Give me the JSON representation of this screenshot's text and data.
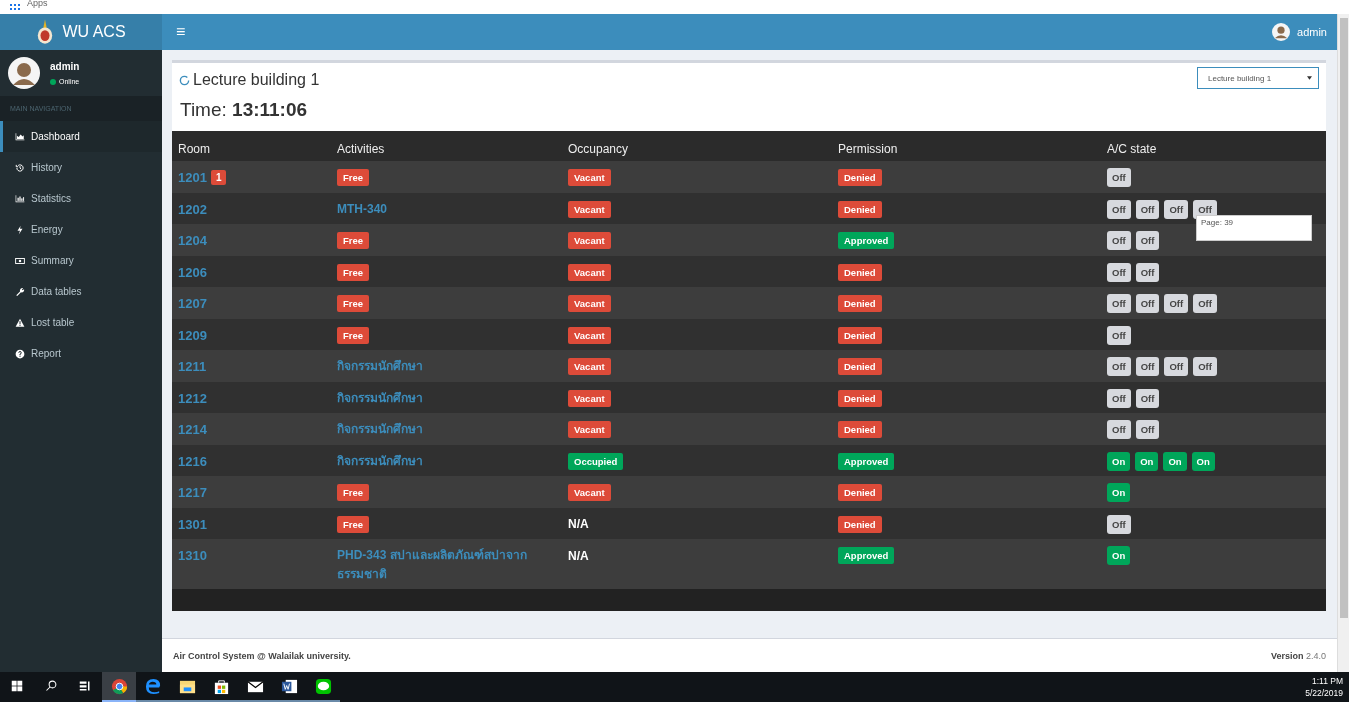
{
  "browser_bar": {
    "apps_label": "Apps"
  },
  "header": {
    "brand": "WU ACS",
    "menu_glyph": "≡",
    "user": "admin"
  },
  "sidebar": {
    "user": {
      "name": "admin",
      "status": "Online"
    },
    "section_label": "MAIN NAVIGATION",
    "items": [
      {
        "label": "Dashboard",
        "selected": true
      },
      {
        "label": "History",
        "selected": false
      },
      {
        "label": "Statistics",
        "selected": false
      },
      {
        "label": "Energy",
        "selected": false
      },
      {
        "label": "Summary",
        "selected": false
      },
      {
        "label": "Data tables",
        "selected": false
      },
      {
        "label": "Lost table",
        "selected": false
      },
      {
        "label": "Report",
        "selected": false
      }
    ]
  },
  "content": {
    "title": "Lecture building 1",
    "time_label": "Time:",
    "time": "13:11:06",
    "building_select": {
      "value": "Lecture building 1"
    },
    "table": {
      "columns": [
        "Room",
        "Activities",
        "Occupancy",
        "Permission",
        "A/C state"
      ],
      "rows": [
        {
          "room": "1201",
          "alert_badge": "1",
          "activity": {
            "kind": "badge",
            "text": "Free",
            "color": "#dd4b39"
          },
          "occupancy": {
            "kind": "badge",
            "text": "Vacant",
            "color": "#dd4b39"
          },
          "permission": {
            "text": "Denied",
            "color": "#dd4b39"
          },
          "ac": [
            {
              "label": "Off",
              "on": false
            }
          ]
        },
        {
          "room": "1202",
          "activity": {
            "kind": "link",
            "text": "MTH-340"
          },
          "occupancy": {
            "kind": "badge",
            "text": "Vacant",
            "color": "#dd4b39"
          },
          "permission": {
            "text": "Denied",
            "color": "#dd4b39"
          },
          "ac": [
            {
              "label": "Off",
              "on": false
            },
            {
              "label": "Off",
              "on": false
            },
            {
              "label": "Off",
              "on": false
            },
            {
              "label": "Off",
              "on": false
            }
          ]
        },
        {
          "room": "1204",
          "activity": {
            "kind": "badge",
            "text": "Free",
            "color": "#dd4b39"
          },
          "occupancy": {
            "kind": "badge",
            "text": "Vacant",
            "color": "#dd4b39"
          },
          "permission": {
            "text": "Approved",
            "color": "#00a65a"
          },
          "ac": [
            {
              "label": "Off",
              "on": false
            },
            {
              "label": "Off",
              "on": false
            }
          ]
        },
        {
          "room": "1206",
          "activity": {
            "kind": "badge",
            "text": "Free",
            "color": "#dd4b39"
          },
          "occupancy": {
            "kind": "badge",
            "text": "Vacant",
            "color": "#dd4b39"
          },
          "permission": {
            "text": "Denied",
            "color": "#dd4b39"
          },
          "ac": [
            {
              "label": "Off",
              "on": false
            },
            {
              "label": "Off",
              "on": false
            }
          ]
        },
        {
          "room": "1207",
          "activity": {
            "kind": "badge",
            "text": "Free",
            "color": "#dd4b39"
          },
          "occupancy": {
            "kind": "badge",
            "text": "Vacant",
            "color": "#dd4b39"
          },
          "permission": {
            "text": "Denied",
            "color": "#dd4b39"
          },
          "ac": [
            {
              "label": "Off",
              "on": false
            },
            {
              "label": "Off",
              "on": false
            },
            {
              "label": "Off",
              "on": false
            },
            {
              "label": "Off",
              "on": false
            }
          ]
        },
        {
          "room": "1209",
          "activity": {
            "kind": "badge",
            "text": "Free",
            "color": "#dd4b39"
          },
          "occupancy": {
            "kind": "badge",
            "text": "Vacant",
            "color": "#dd4b39"
          },
          "permission": {
            "text": "Denied",
            "color": "#dd4b39"
          },
          "ac": [
            {
              "label": "Off",
              "on": false
            }
          ]
        },
        {
          "room": "1211",
          "activity": {
            "kind": "link",
            "text": "กิจกรรมนักศึกษา"
          },
          "occupancy": {
            "kind": "badge",
            "text": "Vacant",
            "color": "#dd4b39"
          },
          "permission": {
            "text": "Denied",
            "color": "#dd4b39"
          },
          "ac": [
            {
              "label": "Off",
              "on": false
            },
            {
              "label": "Off",
              "on": false
            },
            {
              "label": "Off",
              "on": false
            },
            {
              "label": "Off",
              "on": false
            }
          ]
        },
        {
          "room": "1212",
          "activity": {
            "kind": "link",
            "text": "กิจกรรมนักศึกษา"
          },
          "occupancy": {
            "kind": "badge",
            "text": "Vacant",
            "color": "#dd4b39"
          },
          "permission": {
            "text": "Denied",
            "color": "#dd4b39"
          },
          "ac": [
            {
              "label": "Off",
              "on": false
            },
            {
              "label": "Off",
              "on": false
            }
          ]
        },
        {
          "room": "1214",
          "activity": {
            "kind": "link",
            "text": "กิจกรรมนักศึกษา"
          },
          "occupancy": {
            "kind": "badge",
            "text": "Vacant",
            "color": "#dd4b39"
          },
          "permission": {
            "text": "Denied",
            "color": "#dd4b39"
          },
          "ac": [
            {
              "label": "Off",
              "on": false
            },
            {
              "label": "Off",
              "on": false
            }
          ]
        },
        {
          "room": "1216",
          "activity": {
            "kind": "link",
            "text": "กิจกรรมนักศึกษา"
          },
          "occupancy": {
            "kind": "badge",
            "text": "Occupied",
            "color": "#00a65a"
          },
          "permission": {
            "text": "Approved",
            "color": "#00a65a"
          },
          "ac": [
            {
              "label": "On",
              "on": true
            },
            {
              "label": "On",
              "on": true
            },
            {
              "label": "On",
              "on": true
            },
            {
              "label": "On",
              "on": true
            }
          ]
        },
        {
          "room": "1217",
          "activity": {
            "kind": "badge",
            "text": "Free",
            "color": "#dd4b39"
          },
          "occupancy": {
            "kind": "badge",
            "text": "Vacant",
            "color": "#dd4b39"
          },
          "permission": {
            "text": "Denied",
            "color": "#dd4b39"
          },
          "ac": [
            {
              "label": "On",
              "on": true
            }
          ]
        },
        {
          "room": "1301",
          "activity": {
            "kind": "badge",
            "text": "Free",
            "color": "#dd4b39"
          },
          "occupancy": {
            "kind": "text",
            "text": "N/A"
          },
          "permission": {
            "text": "Denied",
            "color": "#dd4b39"
          },
          "ac": [
            {
              "label": "Off",
              "on": false
            }
          ]
        },
        {
          "room": "1310",
          "activity": {
            "kind": "link",
            "text": "PHD-343 สปาและผลิตภัณฑ์สปาจากธรรมชาติ"
          },
          "occupancy": {
            "kind": "text",
            "text": "N/A"
          },
          "permission": {
            "text": "Approved",
            "color": "#00a65a"
          },
          "ac": [
            {
              "label": "On",
              "on": true
            }
          ]
        }
      ]
    },
    "tooltip": "Page: 39"
  },
  "footer": {
    "credit": "Air Control System @ Walailak university.",
    "version_label": "Version",
    "version": "2.4.0"
  },
  "taskbar": {
    "apps": [
      {
        "selected": true
      },
      {
        "selected": false
      },
      {
        "selected": false
      },
      {
        "selected": false
      },
      {
        "selected": false
      },
      {
        "selected": false
      },
      {
        "selected": false
      }
    ],
    "time": "1:11 PM",
    "date": "5/22/2019"
  }
}
